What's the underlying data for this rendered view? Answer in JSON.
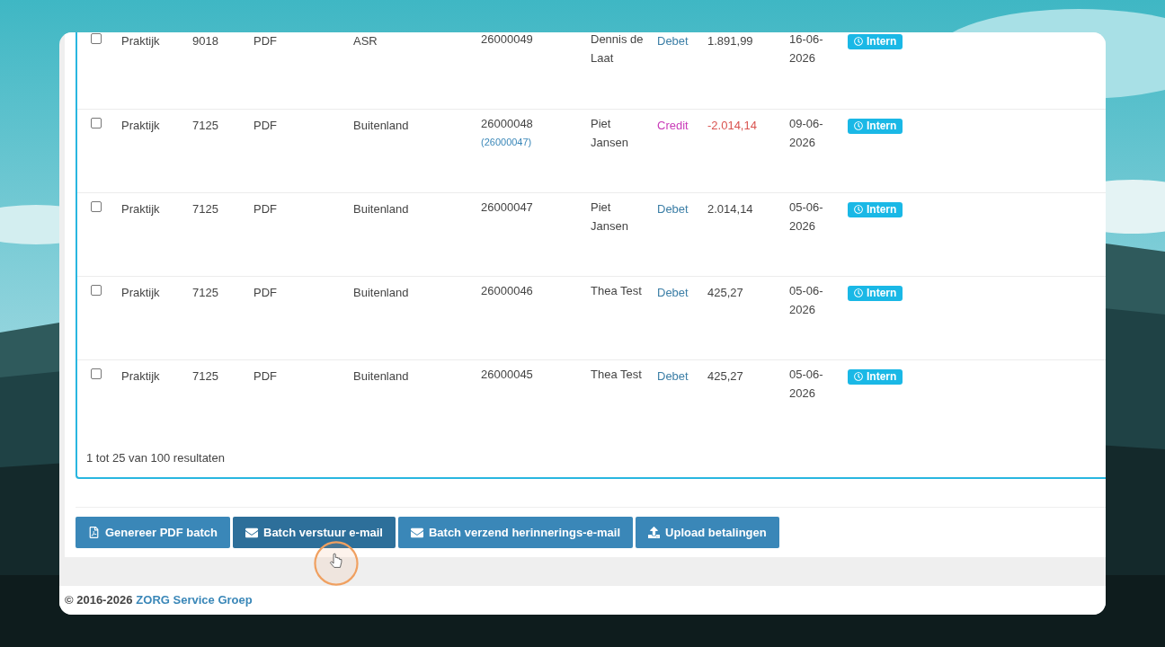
{
  "table": {
    "rows": [
      {
        "checked": false,
        "type": "Praktijk",
        "code": "9018",
        "format": "PDF",
        "insurer": "ASR",
        "number": "26000049",
        "name": "Dennis de Laat",
        "kind": "debit",
        "direction": "Debet",
        "amount": "1.891,99",
        "date": "16-06-2026",
        "badge": "Intern"
      },
      {
        "checked": false,
        "type": "Praktijk",
        "code": "7125",
        "format": "PDF",
        "insurer": "Buitenland",
        "number": "26000048",
        "reference": "(26000047)",
        "name": "Piet Jansen",
        "kind": "credit",
        "direction": "Credit",
        "amount": "-2.014,14",
        "date": "09-06-2026",
        "badge": "Intern"
      },
      {
        "checked": false,
        "type": "Praktijk",
        "code": "7125",
        "format": "PDF",
        "insurer": "Buitenland",
        "number": "26000047",
        "name": "Piet Jansen",
        "kind": "debit",
        "direction": "Debet",
        "amount": "2.014,14",
        "date": "05-06-2026",
        "badge": "Intern"
      },
      {
        "checked": false,
        "type": "Praktijk",
        "code": "7125",
        "format": "PDF",
        "insurer": "Buitenland",
        "number": "26000046",
        "name": "Thea Test",
        "kind": "debit",
        "direction": "Debet",
        "amount": "425,27",
        "date": "05-06-2026",
        "badge": "Intern"
      },
      {
        "checked": false,
        "type": "Praktijk",
        "code": "7125",
        "format": "PDF",
        "insurer": "Buitenland",
        "number": "26000045",
        "name": "Thea Test",
        "kind": "debit",
        "direction": "Debet",
        "amount": "425,27",
        "date": "05-06-2026",
        "badge": "Intern"
      }
    ],
    "summary": "1 tot 25 van 100 resultaten"
  },
  "buttons": [
    {
      "kind": "pdf",
      "label": "Genereer PDF batch",
      "hovered": false
    },
    {
      "kind": "mail",
      "label": "Batch verstuur e-mail",
      "hovered": true
    },
    {
      "kind": "mail",
      "label": "Batch verzend herinnerings-e-mail",
      "hovered": false
    },
    {
      "kind": "upload",
      "label": "Upload betalingen",
      "hovered": false
    }
  ],
  "footer": {
    "copyright": "© 2016-2026",
    "link": "ZORG Service Groep"
  }
}
